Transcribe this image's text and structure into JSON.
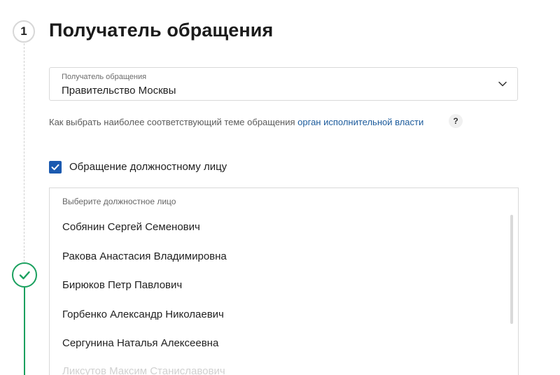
{
  "step": {
    "number": "1",
    "title": "Получатель обращения"
  },
  "recipient_select": {
    "label": "Получатель обращения",
    "value": "Правительство Москвы",
    "icon": "chevron-down-icon"
  },
  "hint": {
    "text": "Как выбрать наиболее соответствующий теме обращения ",
    "link": "орган исполнительной власти",
    "help_icon": "?"
  },
  "official_checkbox": {
    "checked": true,
    "label": "Обращение должностному лицу"
  },
  "official_dropdown": {
    "header": "Выберите должностное лицо",
    "options": [
      "Собянин Сергей Семенович",
      "Ракова Анастасия Владимировна",
      "Бирюков Петр Павлович",
      "Горбенко Александр Николаевич",
      "Сергунина Наталья Алексеевна",
      "Ликсутов Максим Станиславович"
    ]
  },
  "colors": {
    "accent_green": "#1aa05e",
    "checkbox_blue": "#1b5ab0",
    "link_blue": "#1c5b9c"
  }
}
